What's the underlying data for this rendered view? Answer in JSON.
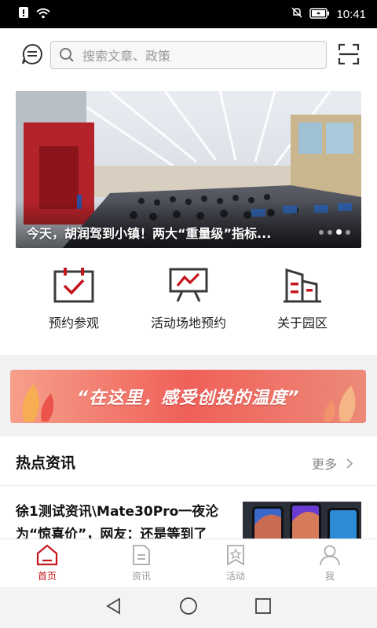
{
  "status_bar": {
    "time": "10:41",
    "icons_left": [
      "alert-icon",
      "wifi-icon"
    ],
    "icons_right": [
      "mute-icon",
      "battery-icon"
    ]
  },
  "header": {
    "message_icon": "chat-icon",
    "search": {
      "placeholder": "搜索文章、政策",
      "icon": "search-icon"
    },
    "scan_icon": "scan-icon"
  },
  "banner": {
    "caption": "今天，胡润驾到小镇！两大“重量级”指标...",
    "dots_total": 4,
    "active_dot": 3
  },
  "quick_menu": [
    {
      "label": "预约参观",
      "icon": "calendar-check-icon"
    },
    {
      "label": "活动场地预约",
      "icon": "presentation-board-icon"
    },
    {
      "label": "关于园区",
      "icon": "buildings-icon"
    }
  ],
  "promo": {
    "text": "“在这里，感受创投的温度”"
  },
  "hot_news": {
    "title": "热点资讯",
    "more_label": "更多",
    "items": [
      {
        "title": "徐1测试资讯\\Mate30Pro一夜沦为“惊喜价”，网友：还是等到了"
      }
    ]
  },
  "tab_bar": {
    "active": 0,
    "tabs": [
      {
        "label": "首页",
        "icon": "home-icon"
      },
      {
        "label": "资讯",
        "icon": "document-icon"
      },
      {
        "label": "活动",
        "icon": "activity-icon"
      },
      {
        "label": "我",
        "icon": "user-icon"
      }
    ]
  },
  "colors": {
    "brand_red": "#c4161c",
    "icon_dark": "#3a3a3a",
    "inactive": "#aaaaaa"
  }
}
